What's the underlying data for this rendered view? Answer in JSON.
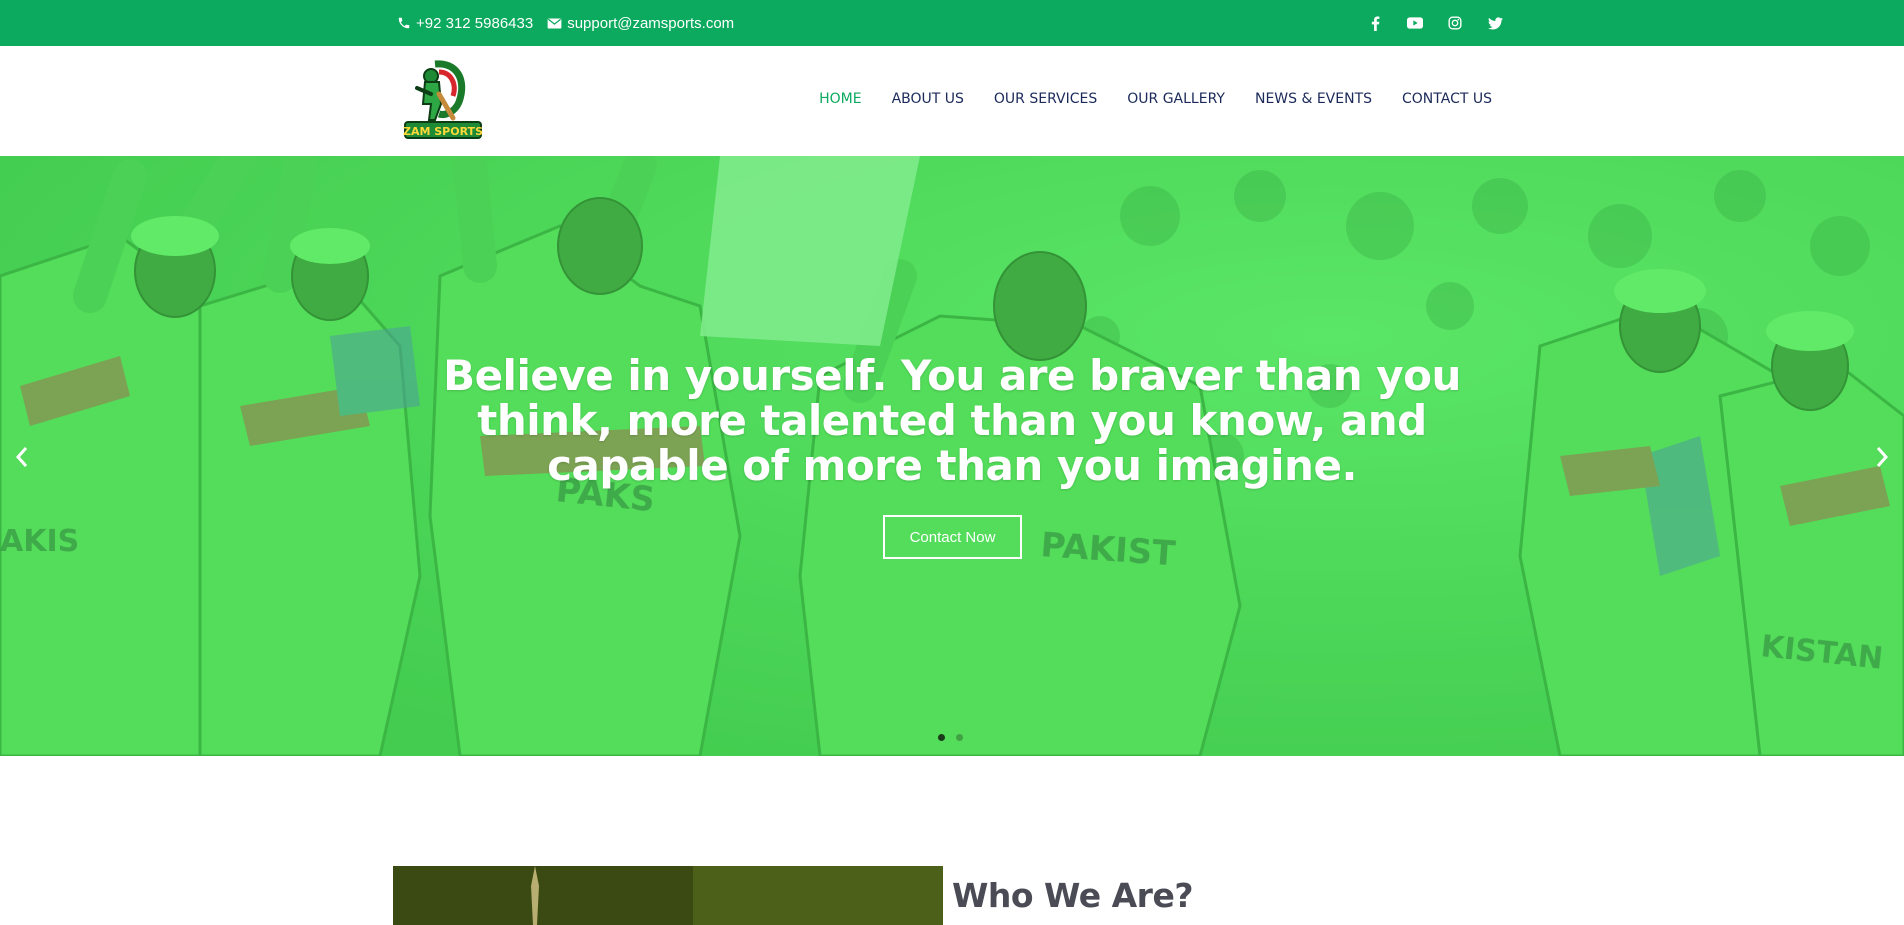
{
  "topbar": {
    "phone": "+92 312 5986433",
    "email": "support@zamsports.com",
    "social": [
      "facebook-icon",
      "youtube-icon",
      "instagram-icon",
      "twitter-icon"
    ]
  },
  "logo": {
    "text": "ZAM SPORTS"
  },
  "nav": {
    "items": [
      "HOME",
      "ABOUT US",
      "OUR SERVICES",
      "OUR GALLERY",
      "NEWS & EVENTS",
      "CONTACT US"
    ],
    "active": "HOME"
  },
  "hero": {
    "headline": "Believe in yourself. You are braver than you think, more talented than you know, and capable of more than you imagine.",
    "cta": "Contact Now",
    "slides_total": 2,
    "active_slide": 1
  },
  "about": {
    "title": "Who We Are?"
  },
  "colors": {
    "brand_green": "#0baa5e",
    "nav_text": "#1b2a5a",
    "overlay_green": "#4fe05a"
  }
}
